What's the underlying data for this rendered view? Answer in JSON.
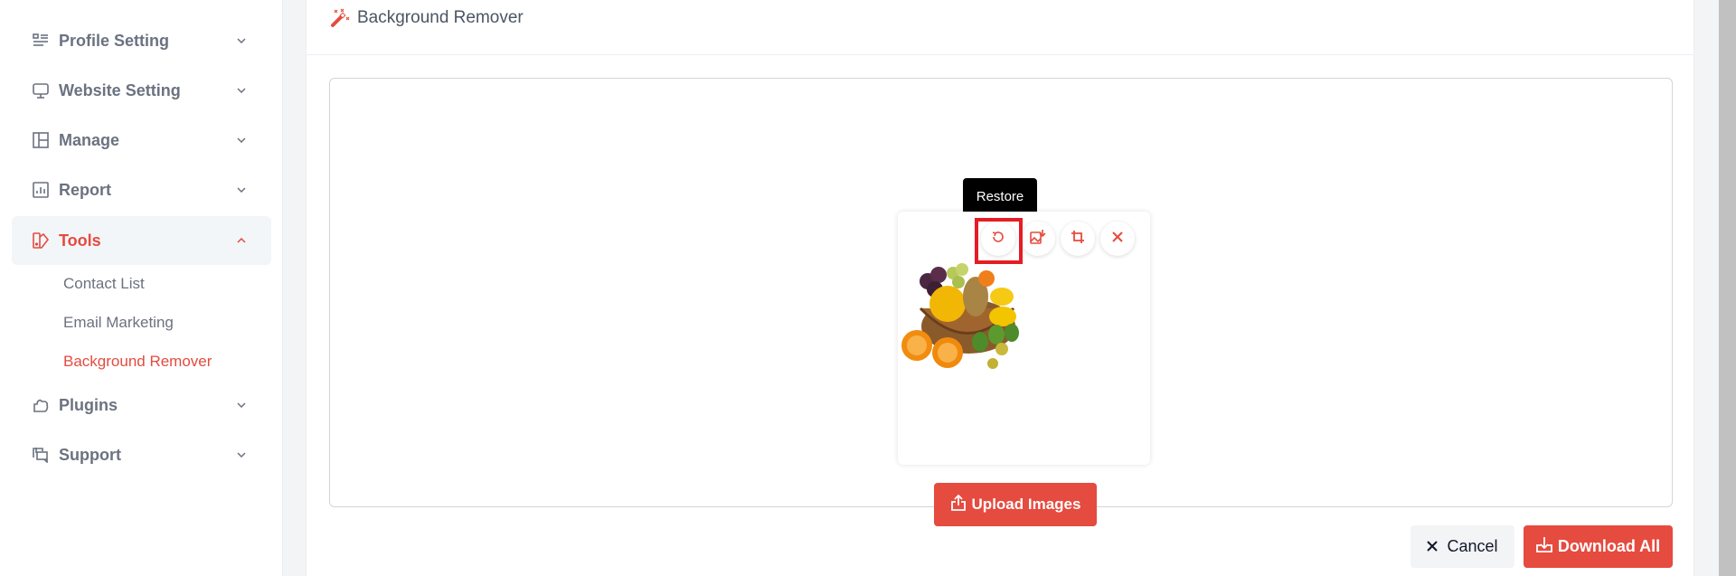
{
  "sidebar": {
    "items": [
      {
        "label": "Profile Setting",
        "icon": "profile-list-icon",
        "expanded": false
      },
      {
        "label": "Website Setting",
        "icon": "monitor-icon",
        "expanded": false
      },
      {
        "label": "Manage",
        "icon": "layout-icon",
        "expanded": false
      },
      {
        "label": "Report",
        "icon": "chart-icon",
        "expanded": false
      },
      {
        "label": "Tools",
        "icon": "tools-icon",
        "expanded": true,
        "active": true
      },
      {
        "label": "Plugins",
        "icon": "puzzle-icon",
        "expanded": false
      },
      {
        "label": "Support",
        "icon": "chat-icon",
        "expanded": false
      }
    ],
    "tools_submenu": [
      {
        "label": "Contact List"
      },
      {
        "label": "Email Marketing"
      },
      {
        "label": "Background Remover",
        "active": true
      }
    ]
  },
  "page": {
    "title": "Background Remover",
    "title_icon": "magic-wand-icon"
  },
  "image_card": {
    "image_alt": "Fruit basket with background removed",
    "actions": [
      {
        "name": "restore",
        "icon": "restore-icon"
      },
      {
        "name": "download-image",
        "icon": "image-download-icon"
      },
      {
        "name": "crop",
        "icon": "crop-icon"
      },
      {
        "name": "remove",
        "icon": "close-icon"
      }
    ],
    "tooltip": "Restore"
  },
  "buttons": {
    "upload": "Upload Images",
    "cancel": "Cancel",
    "download_all": "Download All"
  },
  "colors": {
    "accent": "#e54b3f",
    "muted_text": "#6b7280",
    "active_bg": "#f2f6f9",
    "highlight": "#e41d25"
  }
}
